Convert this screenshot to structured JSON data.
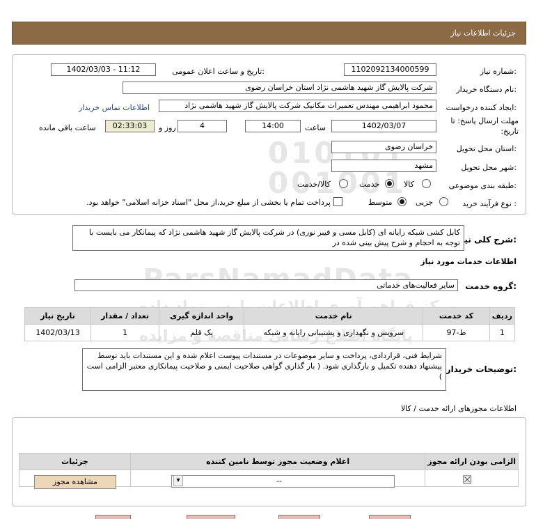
{
  "page": {
    "title": "جزئیات اطلاعات نیاز"
  },
  "form": {
    "need_number_label": "شماره نیاز:",
    "need_number": "1102092134000599",
    "announce_label": "تاریخ و ساعت اعلان عمومی:",
    "announce_value": "1402/03/03 - 11:12",
    "buyer_org_label": "نام دستگاه خریدار:",
    "buyer_org": "شرکت پالایش گاز شهید هاشمی نژاد   استان خراسان رضوی",
    "requester_label": "ایجاد کننده درخواست:",
    "requester": "محمود ابراهیمی مهندس تعمیرات مکانیک شرکت پالایش گاز شهید هاشمی نژاد",
    "contact_link": "اطلاعات تماس خریدار",
    "deadline_label": "مهلت ارسال پاسخ: تا تاریخ:",
    "deadline_date": "1402/03/07",
    "time_label": "ساعت",
    "deadline_time": "14:00",
    "days_value": "4",
    "days_label": "روز و",
    "remaining_time": "02:33:03",
    "remaining_label": "ساعت باقی مانده",
    "province_label": "استان محل تحویل:",
    "province": "خراسان رضوی",
    "city_label": "شهر محل تحویل:",
    "city": "مشهد",
    "category_label": "طبقه بندی موضوعی:",
    "category_options": [
      "کالا",
      "خدمت",
      "کالا/خدمت"
    ],
    "category_selected": "خدمت",
    "process_label": "نوع فرآیند خرید :",
    "process_options": [
      "جزیی",
      "متوسط"
    ],
    "process_selected": "متوسط",
    "payment_note": "پرداخت تمام یا بخشی از مبلغ خرید،از محل \"اسناد خزانه اسلامی\" خواهد بود."
  },
  "summary": {
    "label": "شرح کلی نیاز:",
    "text": "کابل کشی شبکه رایانه ای (کابل مسی و فیبر نوری) در شرکت پالایش گاز شهید هاشمی نژاد که پیمانکار می بایست با توجه به احجام و شرح پیش بینی شده در"
  },
  "services": {
    "section_title": "اطلاعات خدمات مورد نیاز",
    "group_label": "گروه خدمت:",
    "group_value": "سایر فعالیت‌های خدماتی",
    "table": {
      "headers": [
        "ردیف",
        "کد خدمت",
        "نام خدمت",
        "واحد اندازه گیری",
        "تعداد / مقدار",
        "تاریخ نیاز"
      ],
      "rows": [
        [
          "1",
          "ط-97",
          "سرویس و نگهداری و پشتیبانی رایانه و شبکه",
          "یک قلم",
          "1",
          "1402/03/13"
        ]
      ]
    }
  },
  "buyer_notes": {
    "label": "توضیحات خریدار:",
    "text": "شرایط فنی، قراردادی، پرداخت و سایر موضوعات در مستندات پیوست اعلام شده و این مستندات باید توسط پیشنهاد دهنده تکمیل و  بارگذاری شود. ( بار گذاری گواهی صلاحیت ایمنی و صلاحیت پیمانکاری معتبر الزامی است )"
  },
  "permits": {
    "section_title": "اطلاعات مجوزهای ارائه خدمت / کالا",
    "headers": [
      "الزامی بودن ارائه مجوز",
      "اعلام وضعیت مجوز توسط نامین کننده",
      "جزئیات"
    ],
    "status_value": "--",
    "view_button": "مشاهده مجوز"
  },
  "watermark": {
    "brand": "ParsNamadData",
    "line1": "مرکز فراهم آوری اطلاعات پارس نماد داده",
    "line2": "پایگاه اطلاع رسانی مناقصه و مزایده"
  },
  "icons": {
    "checkbox_icon": "☒",
    "dropdown_icon": "▾"
  },
  "colors": {
    "header_bg": "#8b6a45",
    "link": "#1f3ea8",
    "button_bg": "#ecd7b8",
    "table_head_bg": "#dcdcdc"
  }
}
